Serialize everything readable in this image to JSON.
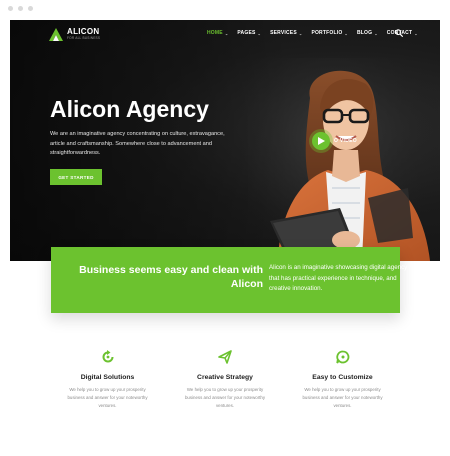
{
  "brand": {
    "name": "ALICON",
    "tagline": "FOR ALL BUSINESS",
    "accent": "#6cc22f",
    "dark": "#161616"
  },
  "nav": {
    "items": [
      {
        "label": "HOME",
        "active": true,
        "has_dropdown": true
      },
      {
        "label": "PAGES",
        "active": false,
        "has_dropdown": true
      },
      {
        "label": "SERVICES",
        "active": false,
        "has_dropdown": true
      },
      {
        "label": "PORTFOLIO",
        "active": false,
        "has_dropdown": true
      },
      {
        "label": "BLOG",
        "active": false,
        "has_dropdown": true
      },
      {
        "label": "CONTACT",
        "active": false,
        "has_dropdown": true
      }
    ],
    "caret": "⌄",
    "search_icon": "search-icon"
  },
  "hero": {
    "title": "Alicon Agency",
    "text": "We are an imaginative agency concentrating on culture, extravagance, article and craftsmanship. Somewhere close to advancement and straightforwardness.",
    "cta_label": "GET STARTED",
    "video_label": "O VIDEO"
  },
  "band": {
    "title": "Business seems easy and clean with Alicon",
    "text": "Alicon is an imaginative showcasing digital agency that has practical experience in technique, and creative innovation."
  },
  "features": [
    {
      "icon": "refresh-icon",
      "title": "Digital Solutions",
      "text": "We help you to grow up your prosperity business and answer for your noteworthy ventures."
    },
    {
      "icon": "send-icon",
      "title": "Creative Strategy",
      "text": "We help you to grow up your prosperity business and answer for your noteworthy ventures."
    },
    {
      "icon": "chat-icon",
      "title": "Easy to Customize",
      "text": "We help you to grow up your prosperity business and answer for your noteworthy ventures."
    }
  ]
}
